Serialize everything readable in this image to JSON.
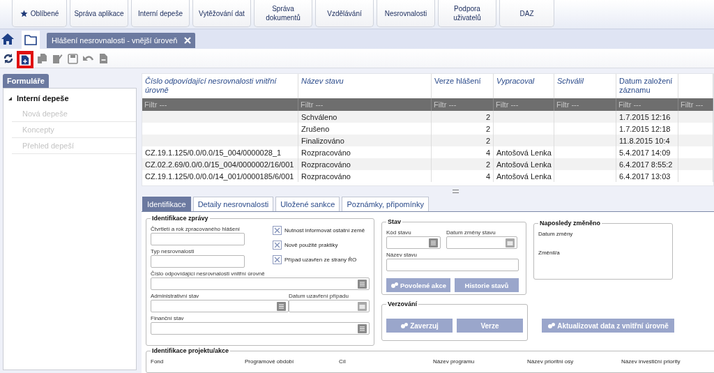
{
  "nav_menu": [
    {
      "label": "Oblíbené",
      "kind": "favorites"
    },
    {
      "label": "Správa aplikace",
      "kind": "plain"
    },
    {
      "label": "Interní depeše",
      "kind": "plain"
    },
    {
      "label": "Vytěžování dat",
      "kind": "plain"
    },
    {
      "label": "Správa dokumentů",
      "kind": "plain"
    },
    {
      "label": "Vzdělávání",
      "kind": "plain"
    },
    {
      "label": "Nesrovnalosti",
      "kind": "plain"
    },
    {
      "label": "Podpora uživatelů",
      "kind": "plain"
    },
    {
      "label": "DAZ",
      "kind": "plain"
    }
  ],
  "document_tabs": [
    {
      "title": "Hlášení nesrovnalosti - vnější úroveň",
      "selected": true
    }
  ],
  "toolbar": [
    {
      "kind": "refresh",
      "disabled": false,
      "highlighted": false
    },
    {
      "kind": "new",
      "disabled": false,
      "highlighted": true
    },
    {
      "kind": "copy",
      "disabled": true,
      "highlighted": false
    },
    {
      "kind": "edit",
      "disabled": true,
      "highlighted": false
    },
    {
      "kind": "save",
      "disabled": true,
      "highlighted": false
    },
    {
      "kind": "undo",
      "disabled": true,
      "highlighted": false
    },
    {
      "kind": "delete",
      "disabled": true,
      "highlighted": false
    }
  ],
  "sidebar": {
    "tab": "Formuláře",
    "items": [
      {
        "label": "Interní depeše",
        "expanded": true,
        "children": [
          {
            "label": "Nová depeše",
            "disabled": true
          },
          {
            "label": "Koncepty",
            "disabled": true
          },
          {
            "label": "Přehled depeší",
            "disabled": true
          }
        ]
      }
    ]
  },
  "table": {
    "columns": [
      {
        "label": "Číslo odpovídající nesrovnalosti vnitřní úrovně",
        "italic": true,
        "kind": "text"
      },
      {
        "label": "Název stavu",
        "italic": true,
        "kind": "text"
      },
      {
        "label": "Verze hlášení",
        "italic": false,
        "kind": "number"
      },
      {
        "label": "Vypracoval",
        "italic": true,
        "kind": "text"
      },
      {
        "label": "Schválil",
        "italic": true,
        "kind": "text"
      },
      {
        "label": "Datum založení záznamu",
        "italic": false,
        "kind": "text"
      }
    ],
    "filters": [
      {
        "placeholder": "Filtr ---"
      },
      {
        "placeholder": "Filtr ---"
      },
      {
        "placeholder": "Filtr ---"
      },
      {
        "placeholder": "Filtr ---"
      },
      {
        "placeholder": "Filtr ---"
      },
      {
        "placeholder": "Filtr ---"
      },
      {
        "placeholder": "Filtr ---"
      }
    ],
    "rows": [
      [
        "",
        "Schváleno",
        "2",
        "",
        "",
        "1.7.2015 12:16"
      ],
      [
        "",
        "Zrušeno",
        "2",
        "",
        "",
        "1.7.2015 12:18"
      ],
      [
        "",
        "Finalizováno",
        "2",
        "",
        "",
        "11.8.2015 10:4"
      ],
      [
        "CZ.19.1.125/0.0/0.0/15_004/0000028_1",
        "Rozpracováno",
        "4",
        "Antošová Lenka",
        "",
        "5.4.2017 14:09"
      ],
      [
        "CZ.02.2.69/0.0/0.0/15_004/0000002/16/001",
        "Rozpracováno",
        "2",
        "Antošová Lenka",
        "",
        "6.4.2017 8:55:2"
      ],
      [
        "CZ.19.1.125/0.0/0.0/14_001/0000185/6/001",
        "Rozpracováno",
        "4",
        "Antošová Lenka",
        "",
        "6.4.2017 13:03"
      ]
    ]
  },
  "detail_tabs": [
    {
      "label": "Identifikace",
      "selected": true
    },
    {
      "label": "Detaily nesrovnalosti",
      "selected": false
    },
    {
      "label": "Uložené sankce",
      "selected": false
    },
    {
      "label": "Poznámky, připomínky",
      "selected": false
    }
  ],
  "identification": {
    "title": "Identifikace zprávy",
    "quarter": {
      "label": "Čtvrtletí a rok zpracovaného hlášení",
      "kind": "text"
    },
    "type": {
      "label": "Typ nesrovnalosti",
      "kind": "text"
    },
    "checkboxes": [
      {
        "label": "Nutnost informovat ostatní země",
        "checked": true
      },
      {
        "label": "Nově použité praktiky",
        "checked": true
      },
      {
        "label": "Případ uzavřen ze strany ŘO",
        "checked": true
      }
    ],
    "number": {
      "label": "Číslo odpovídající nesrovnalosti vnitřní úrovně",
      "kind": "lookup"
    },
    "admin_state": {
      "label": "Administrativní stav",
      "kind": "lookup"
    },
    "closed_date": {
      "label": "Datum uzavření případu",
      "kind": "date"
    },
    "financial_state": {
      "label": "Finanční stav",
      "kind": "lookup"
    }
  },
  "state": {
    "title": "Stav",
    "code": {
      "label": "Kód stavu",
      "kind": "lookup"
    },
    "changed": {
      "label": "Datum změny stavu",
      "kind": "date"
    },
    "name": {
      "label": "Název stavu",
      "kind": "text"
    },
    "buttons": [
      {
        "label": "Povolené akce",
        "kind": "action"
      },
      {
        "label": "Historie stavů",
        "kind": "plain"
      }
    ]
  },
  "last_changed": {
    "title": "Naposledy změněno",
    "labels": [
      "Datum změny",
      "Změnil/a"
    ]
  },
  "versioning": {
    "title": "Verzování",
    "buttons": [
      {
        "label": "Zaverzuj",
        "kind": "action"
      },
      {
        "label": "Verze",
        "kind": "plain"
      }
    ]
  },
  "update_button": {
    "label": "Aktualizovat data z vnitřní úrovně",
    "kind": "action"
  },
  "project": {
    "title": "Identifikace projektu/akce",
    "labels": [
      "Fond",
      "Programové období",
      "Cíl",
      "Název programu",
      "Název prioritní osy",
      "Název investiční priority"
    ]
  }
}
